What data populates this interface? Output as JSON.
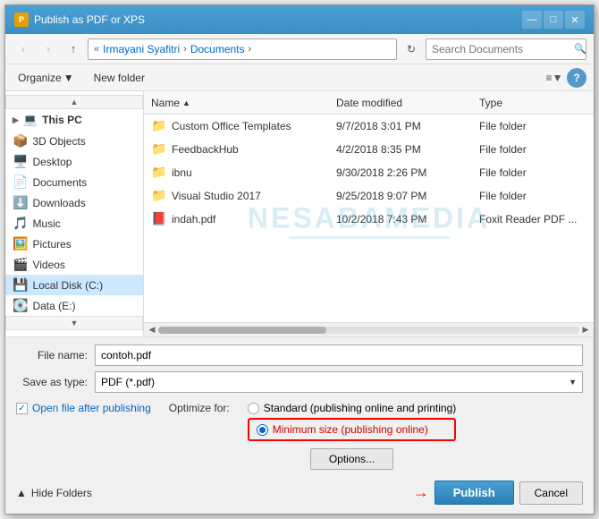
{
  "title": "Publish as PDF or XPS",
  "titlebar": {
    "title_label": "Publish as PDF or XPS",
    "min_label": "—",
    "max_label": "□",
    "close_label": "✕"
  },
  "toolbar": {
    "back_label": "‹",
    "forward_label": "›",
    "up_label": "↑",
    "breadcrumb": [
      "Irmayani Syafitri",
      "Documents"
    ],
    "refresh_label": "↻",
    "search_placeholder": "Search Documents",
    "search_icon": "🔍"
  },
  "second_toolbar": {
    "organize_label": "Organize",
    "organize_arrow": "▼",
    "new_folder_label": "New folder",
    "view_label": "≡",
    "view_arrow": "▼",
    "help_label": "?"
  },
  "file_header": {
    "name_label": "Name",
    "sort_arrow": "▲",
    "date_label": "Date modified",
    "type_label": "Type"
  },
  "sidebar": {
    "items": [
      {
        "icon": "💻",
        "label": "This PC",
        "is_header": true
      },
      {
        "icon": "📦",
        "label": "3D Objects"
      },
      {
        "icon": "🖥️",
        "label": "Desktop"
      },
      {
        "icon": "📄",
        "label": "Documents"
      },
      {
        "icon": "⬇️",
        "label": "Downloads"
      },
      {
        "icon": "🎵",
        "label": "Music"
      },
      {
        "icon": "🖼️",
        "label": "Pictures"
      },
      {
        "icon": "🎬",
        "label": "Videos"
      },
      {
        "icon": "💾",
        "label": "Local Disk (C:)",
        "selected": true
      },
      {
        "icon": "💽",
        "label": "Data (E:)"
      }
    ]
  },
  "files": [
    {
      "icon": "📁",
      "name": "Custom Office Templates",
      "date": "9/7/2018 3:01 PM",
      "type": "File folder"
    },
    {
      "icon": "📁",
      "name": "FeedbackHub",
      "date": "4/2/2018 8:35 PM",
      "type": "File folder"
    },
    {
      "icon": "📁",
      "name": "ibnu",
      "date": "9/30/2018 2:26 PM",
      "type": "File folder"
    },
    {
      "icon": "📁",
      "name": "Visual Studio 2017",
      "date": "9/25/2018 9:07 PM",
      "type": "File folder"
    },
    {
      "icon": "📕",
      "name": "indah.pdf",
      "date": "10/2/2018 7:43 PM",
      "type": "Foxit Reader PDF ..."
    }
  ],
  "watermark": "NESABAMEDIA",
  "form": {
    "filename_label": "File name:",
    "filename_value": "contoh.pdf",
    "savetype_label": "Save as type:",
    "savetype_value": "PDF (*.pdf)"
  },
  "options": {
    "open_file_label": "Open file after publishing",
    "checkbox_checked": "✓",
    "optimize_label": "Optimize for:",
    "standard_label": "Standard (publishing online and printing)",
    "minimum_label": "Minimum size (publishing online)",
    "options_btn": "Options...",
    "standard_checked": false,
    "minimum_checked": true
  },
  "footer": {
    "hide_folders_label": "Hide Folders",
    "hide_icon": "▲",
    "publish_label": "Publish",
    "cancel_label": "Cancel"
  }
}
